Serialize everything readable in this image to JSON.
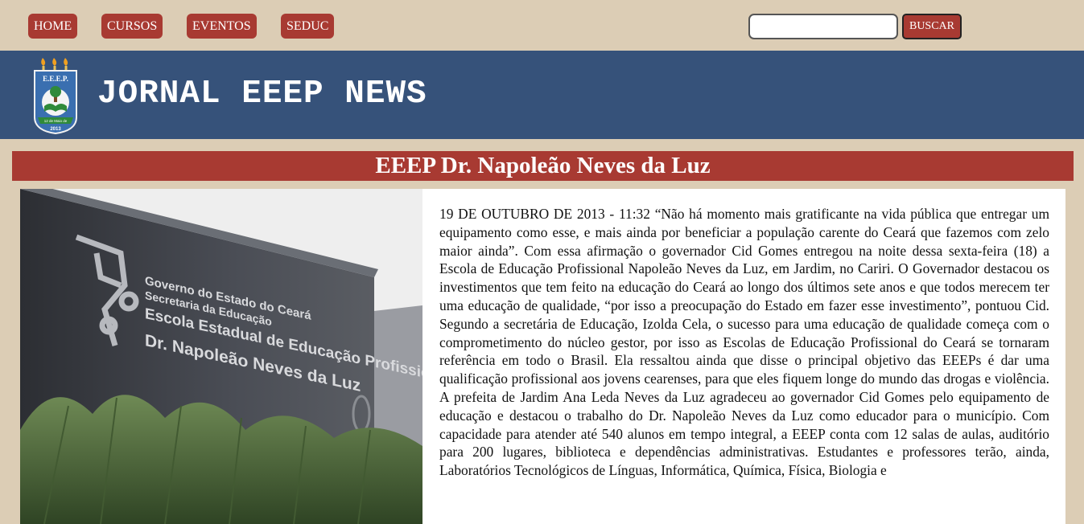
{
  "nav": {
    "items": [
      {
        "label": "HOME"
      },
      {
        "label": "CURSOS"
      },
      {
        "label": "EVENTOS"
      },
      {
        "label": "SEDUC"
      }
    ]
  },
  "search": {
    "value": "",
    "button_label": "BUSCAR"
  },
  "banner": {
    "title": "JORNAL EEEP NEWS",
    "logo": {
      "top_text": "E.E.E.P.",
      "ring_text": "Dr. Napoleão Neves da Luz",
      "ribbon_text": "12 de Maio de",
      "year": "2013"
    }
  },
  "article": {
    "title": "EEEP Dr. Napoleão Neves da Luz",
    "photo": {
      "line1": "Governo do Estado do Ceará",
      "line2": "Secretaria da Educação",
      "line3": "Escola Estadual de Educação Profissional",
      "line4": "Dr. Napoleão Neves da Luz"
    },
    "body": "19 DE OUTUBRO DE 2013 - 11:32 “Não há momento mais gratificante na vida pública que entregar um equipamento como esse, e mais ainda por beneficiar a população carente do Ceará que fazemos com zelo maior ainda”. Com essa afirmação o governador Cid Gomes entregou na noite dessa sexta-feira (18) a Escola de Educação Profissional Napoleão Neves da Luz, em Jardim, no Cariri. O Governador destacou os investimentos que tem feito na educação do Ceará ao longo dos últimos sete anos e que todos merecem ter uma educação de qualidade, “por isso a preocupação do Estado em fazer esse investimento”, pontuou Cid. Segundo a secretária de Educação, Izolda Cela, o sucesso para uma educação de qualidade começa com o comprometimento do núcleo gestor, por isso as Escolas de Educação Profissional do Ceará se tornaram referência em todo o Brasil. Ela ressaltou ainda que disse o principal objetivo das EEEPs é dar uma qualificação profissional aos jovens cearenses, para que eles fiquem longe do mundo das drogas e violência. A prefeita de Jardim Ana Leda Neves da Luz agradeceu ao governador Cid Gomes pelo equipamento de educação e destacou o trabalho do Dr. Napoleão Neves da Luz como educador para o município. Com capacidade para atender até 540 alunos em tempo integral, a EEEP conta com 12 salas de aulas, auditório para 200 lugares, biblioteca e dependências administrativas. Estudantes e professores terão, ainda, Laboratórios Tecnológicos de Línguas, Informática, Química, Física, Biologia e"
  },
  "colors": {
    "page_bg": "#dccdb5",
    "accent_red": "#a83a32",
    "banner_blue": "#36527a",
    "text": "#111111"
  }
}
